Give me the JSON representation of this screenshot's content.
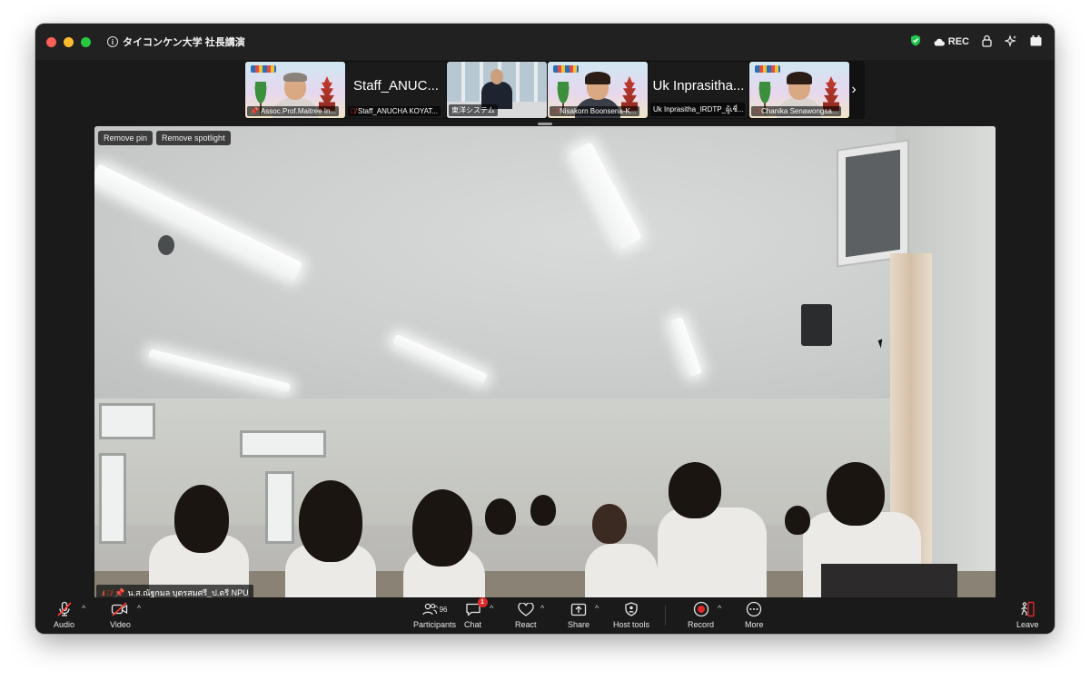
{
  "window": {
    "title": "タイコンケン大学 社長講演",
    "rec_label": "REC"
  },
  "thumbnails": [
    {
      "name": "Assoc.Prof.Maitree In...",
      "type": "video-slide",
      "pinned": true,
      "muted": false
    },
    {
      "name": "Staff_ANUCHA KOYAT...",
      "big_name": "Staff_ANUC...",
      "type": "name-only",
      "muted": true
    },
    {
      "name": "東洋システム",
      "type": "video-office",
      "muted": false
    },
    {
      "name": "Nisakorn Boonsena-K...",
      "type": "video-slide",
      "muted": true
    },
    {
      "name": "Uk Inprasitha_IRDTP_ผู้เชี่...",
      "big_name": "Uk Inprasitha...",
      "type": "name-only",
      "muted": false
    },
    {
      "name": "Chanika Senawongsa...",
      "type": "video-slide",
      "muted": true
    }
  ],
  "main_video": {
    "participant_name": "น.ส.ณัฐกมล บุตรสมศรี_ป.ตรี NPU",
    "remove_pin_label": "Remove pin",
    "remove_spotlight_label": "Remove spotlight"
  },
  "toolbar": {
    "audio_label": "Audio",
    "video_label": "Video",
    "participants_label": "Participants",
    "participants_count": "96",
    "chat_label": "Chat",
    "chat_badge": "1",
    "react_label": "React",
    "share_label": "Share",
    "host_tools_label": "Host tools",
    "record_label": "Record",
    "more_label": "More",
    "leave_label": "Leave"
  },
  "colors": {
    "active_speaker_border": "#3fd65a",
    "record_red": "#e02828",
    "window_bg": "#1a1a1a"
  }
}
